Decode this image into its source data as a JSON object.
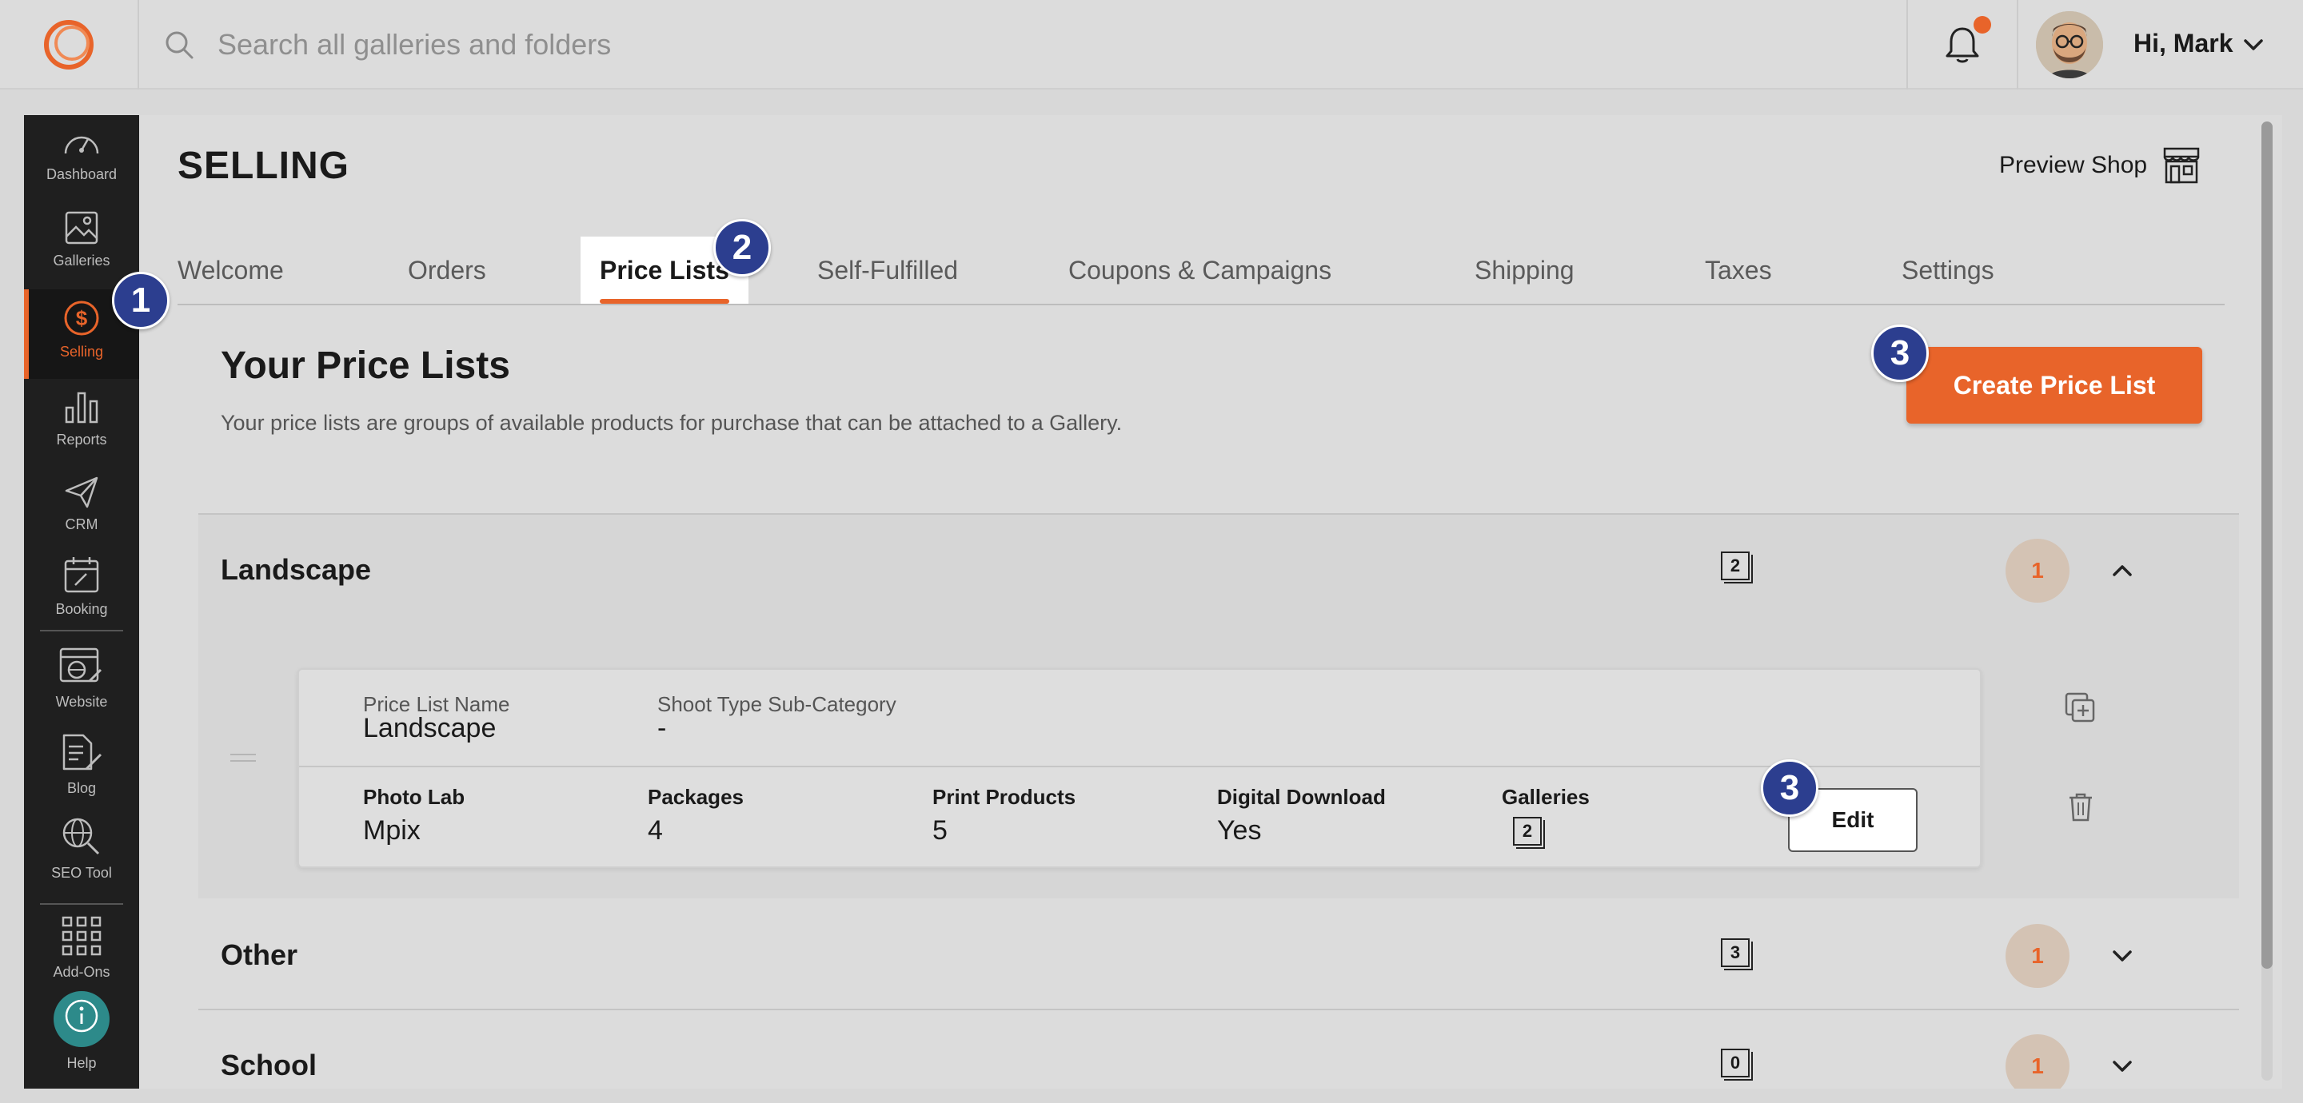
{
  "header": {
    "search_placeholder": "Search all galleries and folders",
    "greeting": "Hi, Mark"
  },
  "sidebar": {
    "items": [
      {
        "label": "Dashboard",
        "icon": "dashboard-icon"
      },
      {
        "label": "Galleries",
        "icon": "galleries-icon"
      },
      {
        "label": "Selling",
        "icon": "selling-icon",
        "active": true
      },
      {
        "label": "Reports",
        "icon": "reports-icon"
      },
      {
        "label": "CRM",
        "icon": "crm-icon"
      },
      {
        "label": "Booking",
        "icon": "booking-icon"
      },
      {
        "label": "Website",
        "icon": "website-icon"
      },
      {
        "label": "Blog",
        "icon": "blog-icon"
      },
      {
        "label": "SEO Tool",
        "icon": "seo-icon"
      },
      {
        "label": "Add-Ons",
        "icon": "addons-icon"
      },
      {
        "label": "Help",
        "icon": "help-icon"
      }
    ]
  },
  "page": {
    "title": "SELLING",
    "preview_shop": "Preview Shop"
  },
  "tabs": [
    {
      "label": "Welcome"
    },
    {
      "label": "Orders"
    },
    {
      "label": "Price Lists",
      "active": true
    },
    {
      "label": "Self-Fulfilled"
    },
    {
      "label": "Coupons & Campaigns"
    },
    {
      "label": "Shipping"
    },
    {
      "label": "Taxes"
    },
    {
      "label": "Settings"
    }
  ],
  "section": {
    "title": "Your Price Lists",
    "description": "Your price lists are groups of available products for purchase that can be attached to a Gallery.",
    "create_button": "Create Price List"
  },
  "badges": [
    "1",
    "2",
    "3",
    "3"
  ],
  "price_lists": [
    {
      "name": "Landscape",
      "gallery_count": "2",
      "count": "1",
      "expanded": true
    },
    {
      "name": "Other",
      "gallery_count": "3",
      "count": "1",
      "expanded": false
    },
    {
      "name": "School",
      "gallery_count": "0",
      "count": "1",
      "expanded": false
    }
  ],
  "detail": {
    "name_label": "Price List Name",
    "name_value": "Landscape",
    "subcat_label": "Shoot Type Sub-Category",
    "subcat_value": "-",
    "photo_lab_label": "Photo Lab",
    "photo_lab_value": "Mpix",
    "packages_label": "Packages",
    "packages_value": "4",
    "print_label": "Print Products",
    "print_value": "5",
    "digital_label": "Digital Download",
    "digital_value": "Yes",
    "galleries_label": "Galleries",
    "galleries_value": "2",
    "edit_button": "Edit"
  },
  "colors": {
    "accent": "#e8642a",
    "sidebar_bg": "#1f1f1f",
    "badge_blue": "#2c3e8f"
  }
}
